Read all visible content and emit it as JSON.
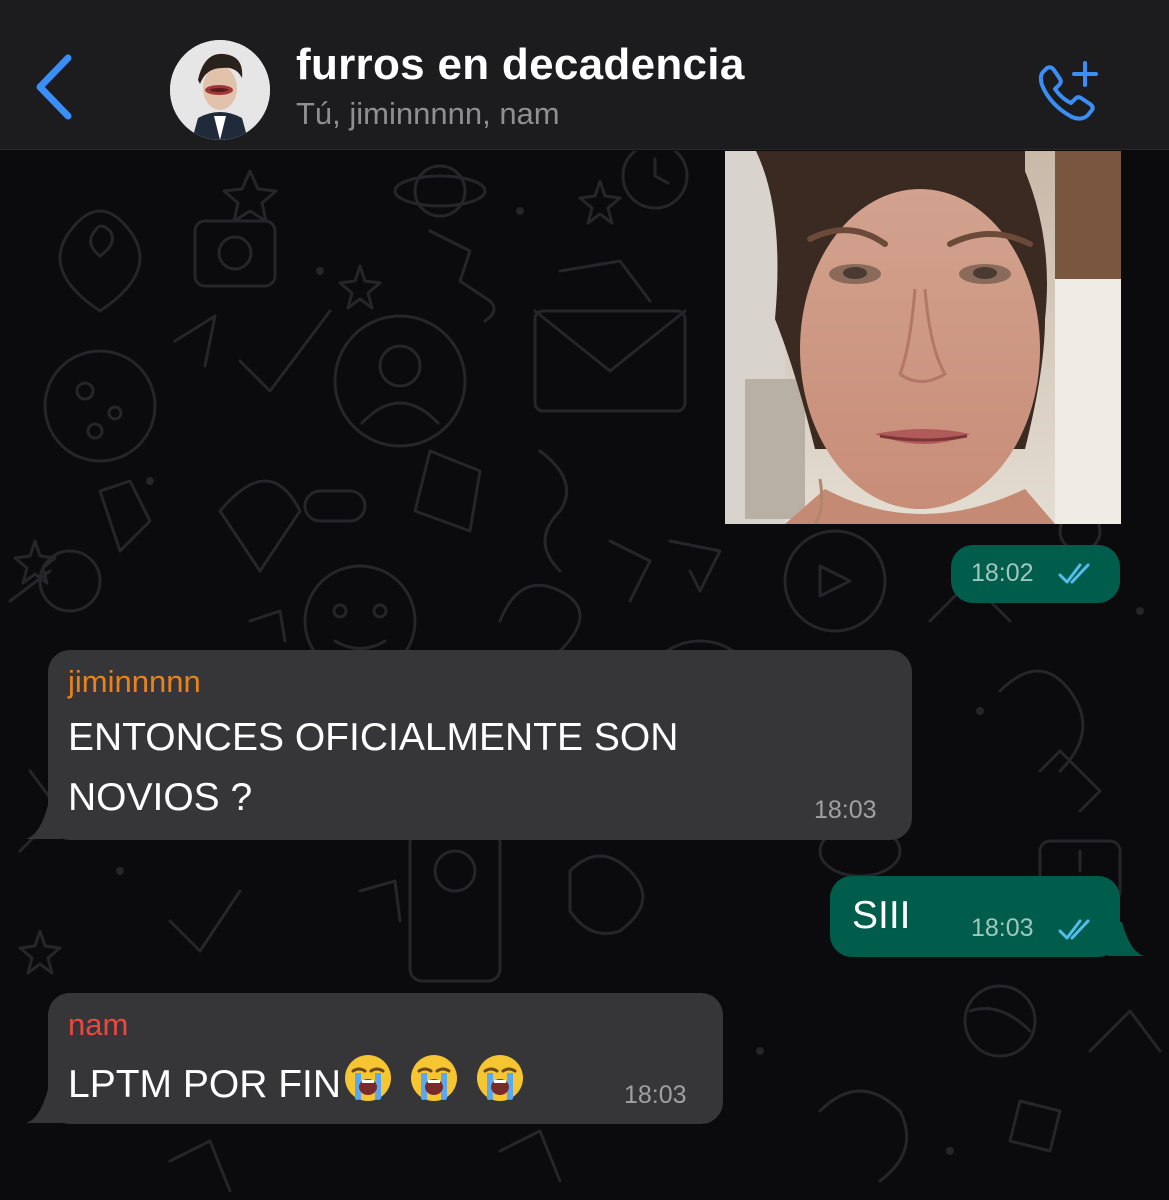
{
  "header": {
    "title": "furros en decadencia",
    "subtitle": "Tú, jiminnnnn, nam"
  },
  "messages": [
    {
      "type": "image",
      "direction": "outgoing",
      "time": "18:02",
      "status": "read"
    },
    {
      "type": "text",
      "direction": "incoming",
      "sender": "jiminnnnn",
      "sender_color": "#e8821b",
      "lines": [
        "ENTONCES OFICIALMENTE SON",
        "NOVIOS ?"
      ],
      "time": "18:03"
    },
    {
      "type": "text",
      "direction": "outgoing",
      "text": "SIII",
      "time": "18:03",
      "status": "read"
    },
    {
      "type": "text",
      "direction": "incoming",
      "sender": "nam",
      "sender_color": "#e8483f",
      "text": "LPTM POR FIN",
      "emojis": [
        "loudly-crying-face",
        "loudly-crying-face",
        "loudly-crying-face"
      ],
      "time": "18:03"
    }
  ],
  "colors": {
    "accent": "#3a8ff7",
    "outgoing_bubble": "#005c4b",
    "incoming_bubble": "#363638",
    "read_ticks": "#53bdeb"
  }
}
